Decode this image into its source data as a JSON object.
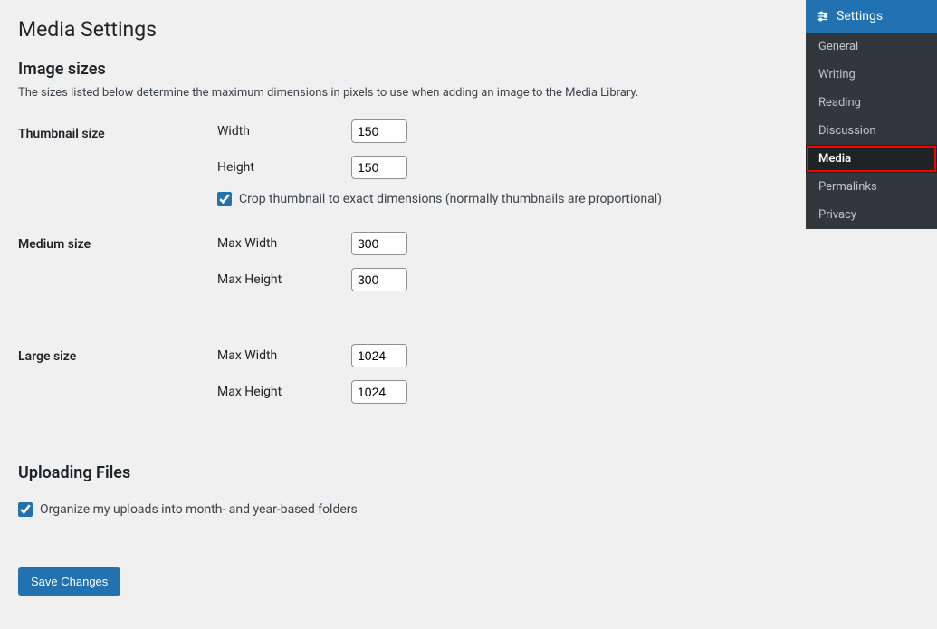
{
  "page": {
    "title": "Media Settings"
  },
  "image_sizes": {
    "section_title": "Image sizes",
    "description": "The sizes listed below determine the maximum dimensions in pixels to use when adding an image to the Media Library.",
    "thumbnail": {
      "label": "Thumbnail size",
      "width_label": "Width",
      "width_value": "150",
      "height_label": "Height",
      "height_value": "150",
      "crop_checked": true,
      "crop_label": "Crop thumbnail to exact dimensions (normally thumbnails are proportional)"
    },
    "medium": {
      "label": "Medium size",
      "max_width_label": "Max Width",
      "max_width_value": "300",
      "max_height_label": "Max Height",
      "max_height_value": "300"
    },
    "large": {
      "label": "Large size",
      "max_width_label": "Max Width",
      "max_width_value": "1024",
      "max_height_label": "Max Height",
      "max_height_value": "1024"
    }
  },
  "uploading": {
    "section_title": "Uploading Files",
    "organize_checked": true,
    "organize_label": "Organize my uploads into month- and year-based folders"
  },
  "buttons": {
    "save": "Save Changes"
  },
  "sidebar": {
    "header": "Settings",
    "items": [
      {
        "label": "General",
        "active": false
      },
      {
        "label": "Writing",
        "active": false
      },
      {
        "label": "Reading",
        "active": false
      },
      {
        "label": "Discussion",
        "active": false
      },
      {
        "label": "Media",
        "active": true
      },
      {
        "label": "Permalinks",
        "active": false
      },
      {
        "label": "Privacy",
        "active": false
      }
    ]
  }
}
